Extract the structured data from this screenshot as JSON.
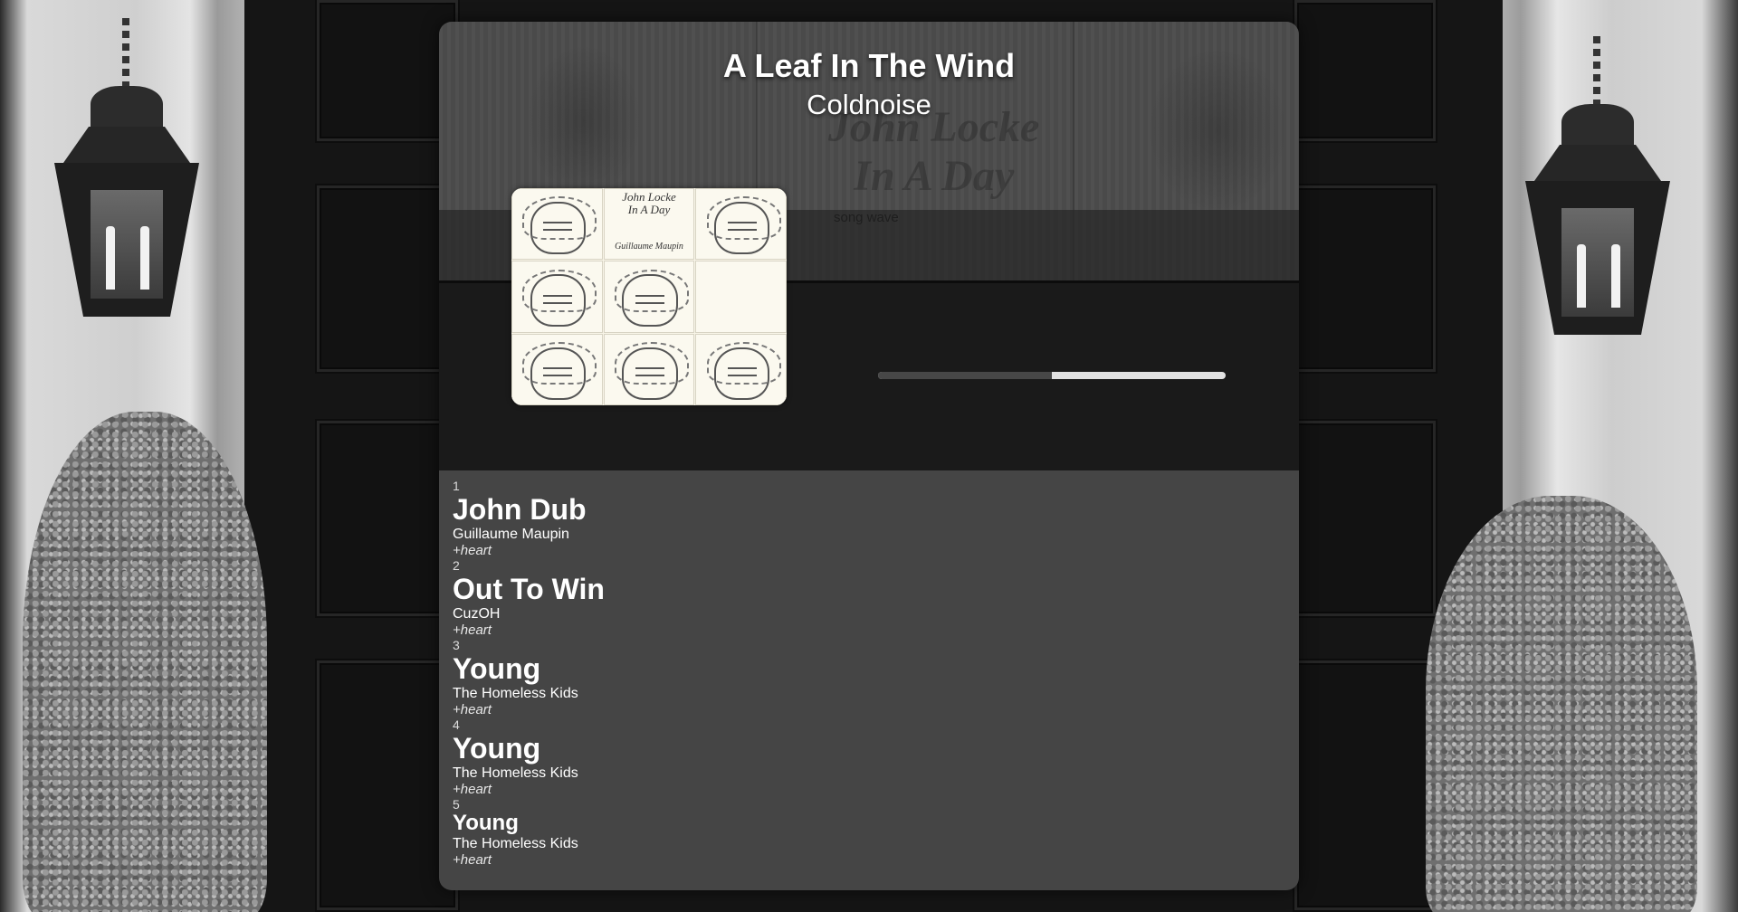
{
  "now_playing": {
    "title": "A Leaf In The Wind",
    "artist": "Coldnoise",
    "wave_label": "song wave",
    "progress_fraction": 0.5
  },
  "album_art": {
    "cover_title_line1": "John Locke",
    "cover_title_line2": "In A Day",
    "cover_artist": "Guillaume Maupin"
  },
  "playlist": {
    "tracks": [
      {
        "number": "1",
        "title": "John Dub",
        "artist": "Guillaume Maupin",
        "heart": "+heart"
      },
      {
        "number": "2",
        "title": "Out To Win",
        "artist": "CuzOH",
        "heart": "+heart"
      },
      {
        "number": "3",
        "title": "Young",
        "artist": "The Homeless Kids",
        "heart": "+heart"
      },
      {
        "number": "4",
        "title": "Young",
        "artist": "The Homeless Kids",
        "heart": "+heart"
      },
      {
        "number": "5",
        "title": "Young",
        "artist": "The Homeless Kids",
        "heart": "+heart"
      }
    ]
  },
  "hero_watermark": {
    "line1": "John Locke",
    "line2": "In A Day"
  }
}
